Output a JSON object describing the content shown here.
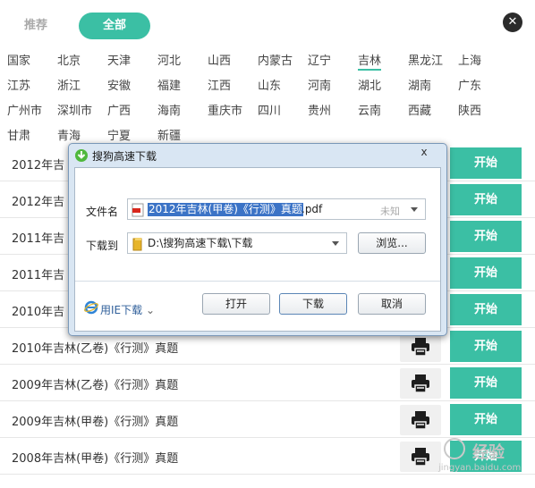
{
  "tabs": {
    "recommended": "推荐",
    "all": "全部"
  },
  "provinces": [
    [
      "国家",
      "北京",
      "天津",
      "河北",
      "山西",
      "内蒙古",
      "辽宁",
      "吉林",
      "黑龙江",
      "上海"
    ],
    [
      "江苏",
      "浙江",
      "安徽",
      "福建",
      "江西",
      "山东",
      "河南",
      "湖北",
      "湖南",
      "广东"
    ],
    [
      "广州市",
      "深圳市",
      "广西",
      "海南",
      "重庆市",
      "四川",
      "贵州",
      "云南",
      "西藏",
      "陕西"
    ],
    [
      "甘肃",
      "青海",
      "宁夏",
      "新疆"
    ]
  ],
  "active_province": "吉林",
  "list": [
    {
      "title": "2012年吉",
      "action": "开始"
    },
    {
      "title": "2012年吉",
      "action": "开始"
    },
    {
      "title": "2011年吉",
      "action": "开始"
    },
    {
      "title": "2011年吉",
      "action": "开始"
    },
    {
      "title": "2010年吉",
      "action": "开始"
    },
    {
      "title": "2010年吉林(乙卷)《行测》真题",
      "action": "开始"
    },
    {
      "title": "2009年吉林(乙卷)《行测》真题",
      "action": "开始"
    },
    {
      "title": "2009年吉林(甲卷)《行测》真题",
      "action": "开始"
    },
    {
      "title": "2008年吉林(甲卷)《行测》真题",
      "action": "开始"
    }
  ],
  "dialog": {
    "title": "搜狗高速下载",
    "close": "x",
    "filename_label": "文件名",
    "filename_selected": "2012年吉林(甲卷)《行测》真题",
    "filename_ext": ".pdf",
    "size_status": "未知",
    "saveto_label": "下载到",
    "saveto_path": "D:\\搜狗高速下载\\下载",
    "browse": "浏览...",
    "ie_download": "用IE下载",
    "open": "打开",
    "download": "下载",
    "cancel": "取消"
  },
  "watermark": {
    "brand": "经验",
    "url": "jingyan.baidu.com"
  },
  "colors": {
    "accent": "#3bbfa4",
    "dialog_frame": "#d9e6f3",
    "selection": "#3b73c6"
  }
}
